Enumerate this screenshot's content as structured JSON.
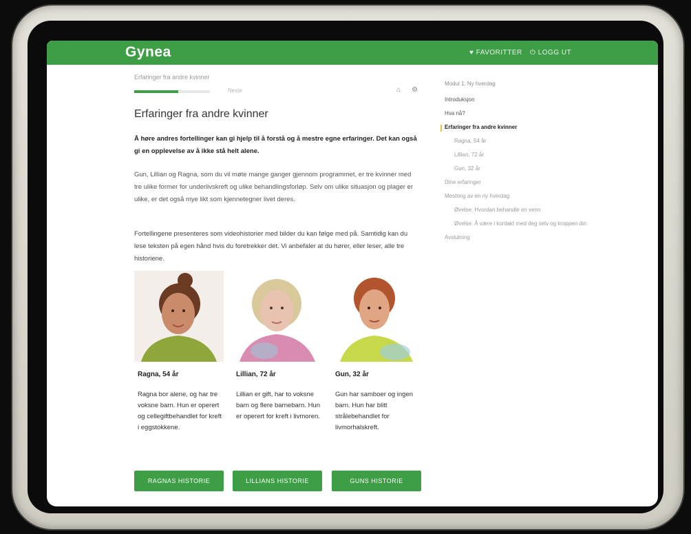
{
  "header": {
    "logo": "Gynea",
    "nav": [
      "♥ FAVORITTER",
      "⏻ LOGG UT"
    ]
  },
  "breadcrumb": "Erfaringer fra andre kvinner",
  "progress": {
    "fraction": 0.58,
    "label": "Neste"
  },
  "page_title": "Erfaringer fra andre kvinner",
  "paragraphs": [
    "Å høre andres fortellinger kan gi hjelp til å forstå og å mestre egne erfaringer. Det kan også gi en opplevelse av å ikke stå helt alene.",
    "Gun, Lillian og Ragna, som du vil møte mange ganger gjennom programmet, er tre kvinner med tre ulike former for underlivskreft og ulike behandlingsforløp. Selv om ulike situasjon og plager er ulike, er det også mye likt som kjennetegner livet deres.",
    "Fortellingene presenteres som videohistorier med bilder du kan følge med på. Samtidig kan du lese teksten på egen hånd hvis du foretrekker det. Vi anbefaler at du hører, eller leser, alle tre historiene."
  ],
  "cards": [
    {
      "name": "Ragna, 54 år",
      "desc": "Ragna bor alene, og har tre voksne barn. Hun er operert og cellegiftbehandlet for kreft i eggstokkene.",
      "button": "RAGNAS HISTORIE",
      "skin": "#c98b6a",
      "hair": "#6b3a22",
      "shirt": "#8fa63b"
    },
    {
      "name": "Lillian, 72 år",
      "desc": "Lillian er gift, har to voksne barn og flere barnebarn. Hun er operert for kreft i livmoren.",
      "button": "LILLIANS HISTORIE",
      "skin": "#e8c4b0",
      "hair": "#d9c99a",
      "shirt": "#d98bb0"
    },
    {
      "name": "Gun, 32 år",
      "desc": "Gun har samboer og ingen barn. Hun har blitt strålebehandlet for livmorhalskreft.",
      "button": "GUNS HISTORIE",
      "skin": "#e0a684",
      "hair": "#b0552e",
      "shirt": "#c7d84a"
    }
  ],
  "sidebar": {
    "heading": "Modul 1: Ny hverdag",
    "items": [
      {
        "label": "Introduksjon",
        "level": 0,
        "state": "normal"
      },
      {
        "label": "Hva nå?",
        "level": 0,
        "state": "normal"
      },
      {
        "label": "Erfaringer fra andre kvinner",
        "level": 0,
        "state": "active"
      },
      {
        "label": "Ragna, 54 år",
        "level": 1,
        "state": "normal"
      },
      {
        "label": "Lillian, 72 år",
        "level": 1,
        "state": "normal"
      },
      {
        "label": "Gun, 32 år",
        "level": 1,
        "state": "normal"
      },
      {
        "label": "Dine erfaringer",
        "level": 0,
        "state": "muted"
      },
      {
        "label": "Mestring av en ny hverdag",
        "level": 0,
        "state": "muted"
      },
      {
        "label": "Øvelse: Hvordan behandle en venn",
        "level": 1,
        "state": "normal"
      },
      {
        "label": "Øvelse: Å være i kontakt med deg selv og kroppen din",
        "level": 1,
        "state": "normal"
      },
      {
        "label": "Avslutning",
        "level": 0,
        "state": "muted"
      }
    ]
  },
  "colors": {
    "brand_green": "#3e9e46",
    "active_marker": "#e6c33a"
  }
}
